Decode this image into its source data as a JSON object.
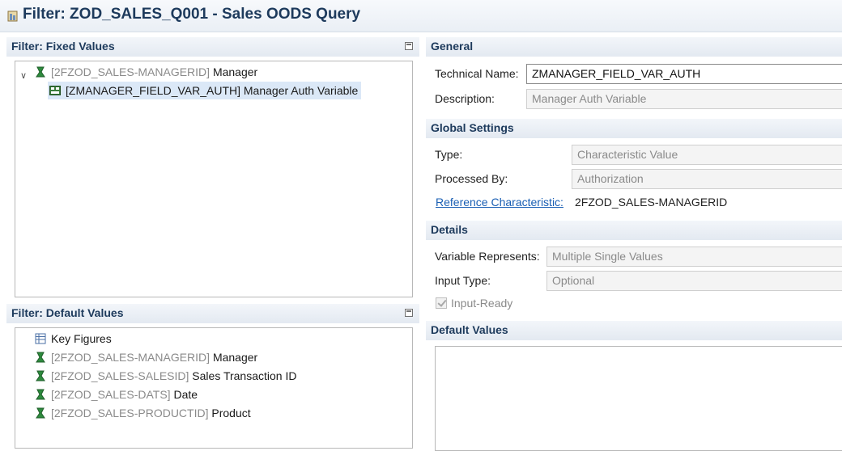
{
  "window": {
    "title": "Filter: ZOD_SALES_Q001 - Sales OODS Query",
    "icon": "query-filter-icon"
  },
  "fixed_values": {
    "header": "Filter: Fixed Values",
    "tree": [
      {
        "tech": "[2FZOD_SALES-MANAGERID]",
        "label": "Manager",
        "icon": "characteristic-icon",
        "expanded": true
      },
      {
        "tech": "",
        "label": "[ZMANAGER_FIELD_VAR_AUTH] Manager Auth Variable",
        "icon": "variable-icon",
        "selected": true
      }
    ]
  },
  "default_values": {
    "header": "Filter: Default Values",
    "tree": [
      {
        "tech": "",
        "label": "Key Figures",
        "icon": "key-figures-icon"
      },
      {
        "tech": "[2FZOD_SALES-MANAGERID]",
        "label": "Manager",
        "icon": "characteristic-icon"
      },
      {
        "tech": "[2FZOD_SALES-SALESID]",
        "label": "Sales Transaction ID",
        "icon": "characteristic-icon"
      },
      {
        "tech": "[2FZOD_SALES-DATS]",
        "label": "Date",
        "icon": "characteristic-icon"
      },
      {
        "tech": "[2FZOD_SALES-PRODUCTID]",
        "label": "Product",
        "icon": "characteristic-icon"
      }
    ]
  },
  "general": {
    "header": "General",
    "technical_name_label": "Technical Name:",
    "technical_name_value": "ZMANAGER_FIELD_VAR_AUTH",
    "description_label": "Description:",
    "description_value": "Manager Auth Variable"
  },
  "global_settings": {
    "header": "Global Settings",
    "type_label": "Type:",
    "type_value": "Characteristic Value",
    "processed_by_label": "Processed By:",
    "processed_by_value": "Authorization",
    "reference_label": "Reference Characteristic:",
    "reference_value": "2FZOD_SALES-MANAGERID"
  },
  "details": {
    "header": "Details",
    "represents_label": "Variable Represents:",
    "represents_value": "Multiple Single Values",
    "input_type_label": "Input Type:",
    "input_type_value": "Optional",
    "input_ready_label": "Input-Ready",
    "input_ready_checked": true
  },
  "default_values_section": {
    "header": "Default Values"
  },
  "colors": {
    "header_text": "#1d3a5c",
    "link": "#1a5fb4",
    "selection": "#dbe8f7",
    "char_icon": "#2e8b3e"
  }
}
